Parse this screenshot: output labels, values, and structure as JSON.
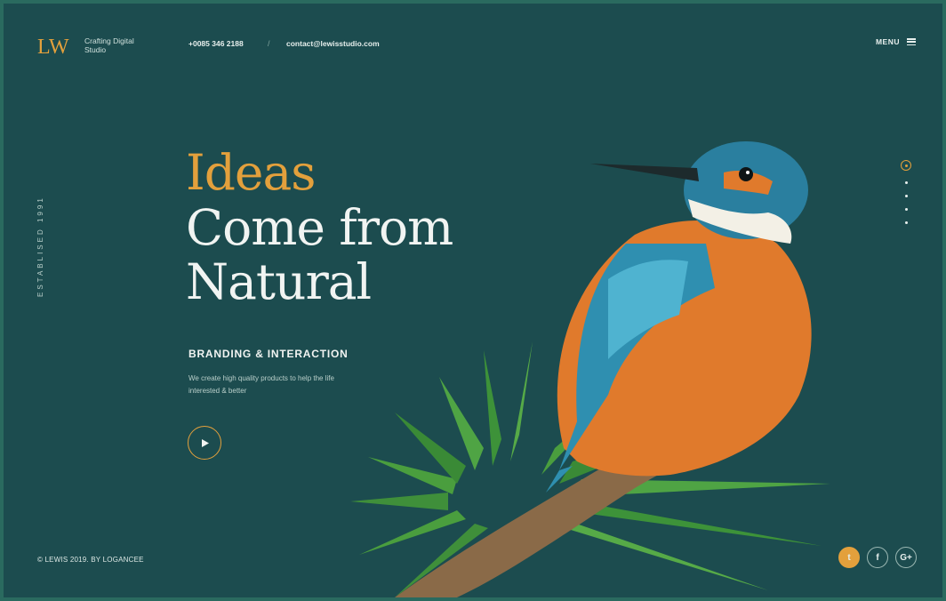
{
  "header": {
    "logo": "LW",
    "tagline": "Crafting Digital Studio",
    "phone": "+0085 346 2188",
    "separator": "/",
    "email": "contact@lewisstudio.com",
    "menu_label": "MENU"
  },
  "side": {
    "established": "ESTABLISED 1991"
  },
  "hero": {
    "line1": "Ideas",
    "line2": "Come from",
    "line3": "Natural",
    "subtitle": "BRANDING & INTERACTION",
    "description": "We create high quality products to help the life interested & better"
  },
  "footer": {
    "copyright": "© LEWIS 2019.  BY LOGANCEE"
  },
  "socials": [
    {
      "icon": "twitter-icon",
      "glyph": "t"
    },
    {
      "icon": "facebook-icon",
      "glyph": "f"
    },
    {
      "icon": "google-plus-icon",
      "glyph": "G+"
    }
  ],
  "slides": {
    "count": 5,
    "active": 1
  },
  "colors": {
    "background": "#1c4c4f",
    "accent": "#e3a03c",
    "text": "#f1f4f2"
  }
}
